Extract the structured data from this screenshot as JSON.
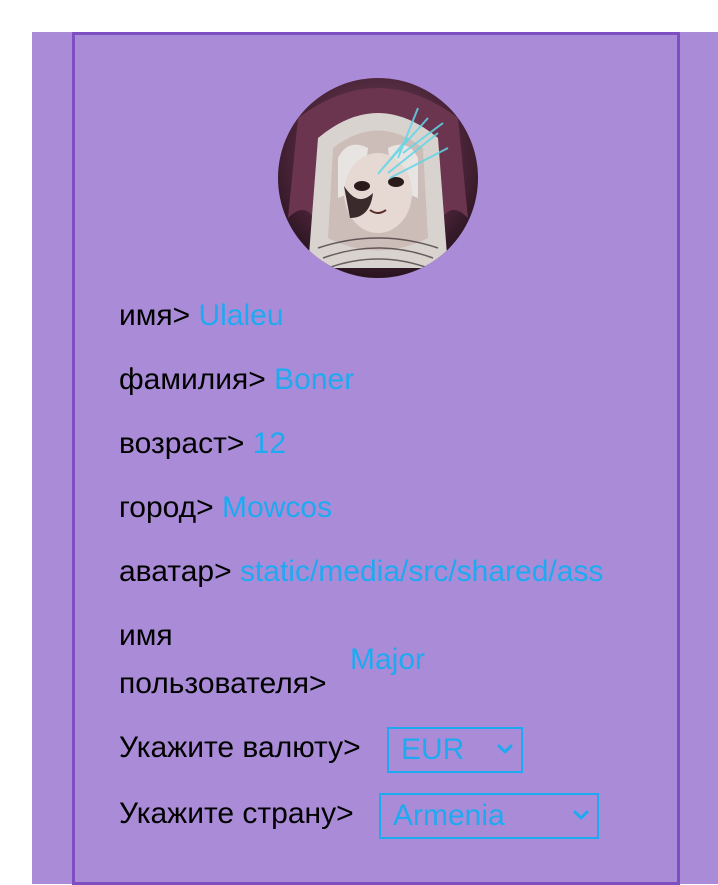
{
  "profile": {
    "first_name_label": "имя>",
    "first_name": "Ulaleu",
    "last_name_label": "фамилия>",
    "last_name": "Boner",
    "age_label": "возраст>",
    "age": "12",
    "city_label": "город>",
    "city": "Mowcos",
    "avatar_label": "аватар>",
    "avatar_path": "static/media/src/shared/ass",
    "username_label_line1": "имя",
    "username_label_line2": "пользователя>",
    "username": "Major",
    "currency_label": "Укажите валюту>",
    "currency_selected": "EUR",
    "country_label": "Укажите страну>",
    "country_selected": "Armenia"
  },
  "colors": {
    "background": "#aa8bd7",
    "border": "#7e4fc1",
    "value": "#1eaaf1"
  }
}
